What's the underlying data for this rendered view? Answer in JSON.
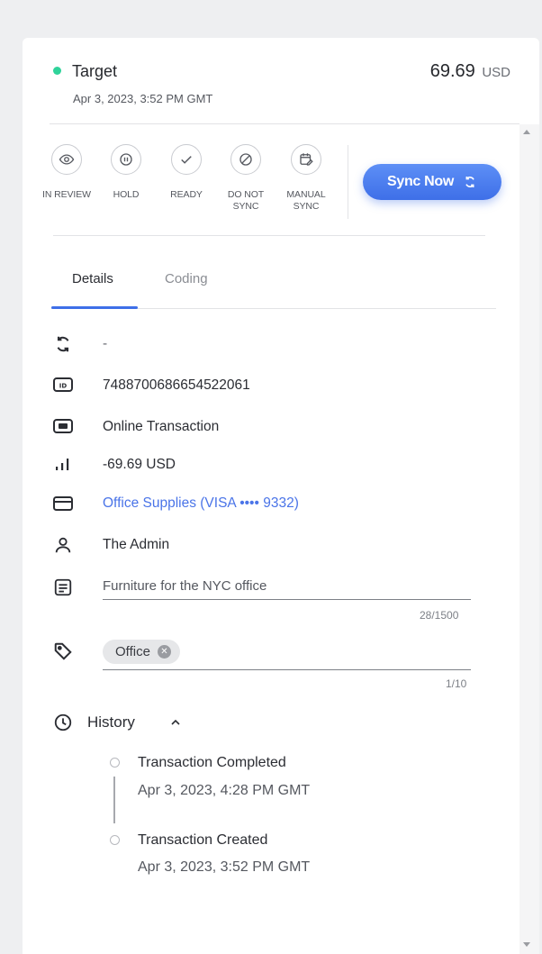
{
  "header": {
    "merchant": "Target",
    "date": "Apr 3, 2023, 3:52 PM GMT",
    "amount": "69.69",
    "currency": "USD",
    "status_color": "#2fd39a"
  },
  "actions": [
    {
      "label_line1": "IN REVIEW",
      "label_line2": "",
      "icon": "eye-icon"
    },
    {
      "label_line1": "HOLD",
      "label_line2": "",
      "icon": "pause-icon"
    },
    {
      "label_line1": "READY",
      "label_line2": "",
      "icon": "check-icon"
    },
    {
      "label_line1": "DO NOT",
      "label_line2": "SYNC",
      "icon": "block-icon"
    },
    {
      "label_line1": "MANUAL",
      "label_line2": "SYNC",
      "icon": "calendar-edit-icon"
    }
  ],
  "sync_button": {
    "label": "Sync Now",
    "icon": "sync-icon",
    "color": "#3e6fe8"
  },
  "tabs": [
    {
      "label": "Details",
      "active": true
    },
    {
      "label": "Coding",
      "active": false
    }
  ],
  "details": {
    "sync_status": "-",
    "transaction_id": "7488700686654522061",
    "transaction_type": "Online Transaction",
    "amount": "-69.69 USD",
    "card": "Office Supplies (VISA •••• 9332)",
    "user": "The Admin",
    "note": "Furniture for the NYC office",
    "note_counter": "28/1500",
    "tag": "Office",
    "tag_counter": "1/10"
  },
  "history": {
    "title": "History",
    "events": [
      {
        "title": "Transaction Completed",
        "date": "Apr 3, 2023, 4:28 PM GMT"
      },
      {
        "title": "Transaction Created",
        "date": "Apr 3, 2023, 3:52 PM GMT"
      }
    ]
  }
}
